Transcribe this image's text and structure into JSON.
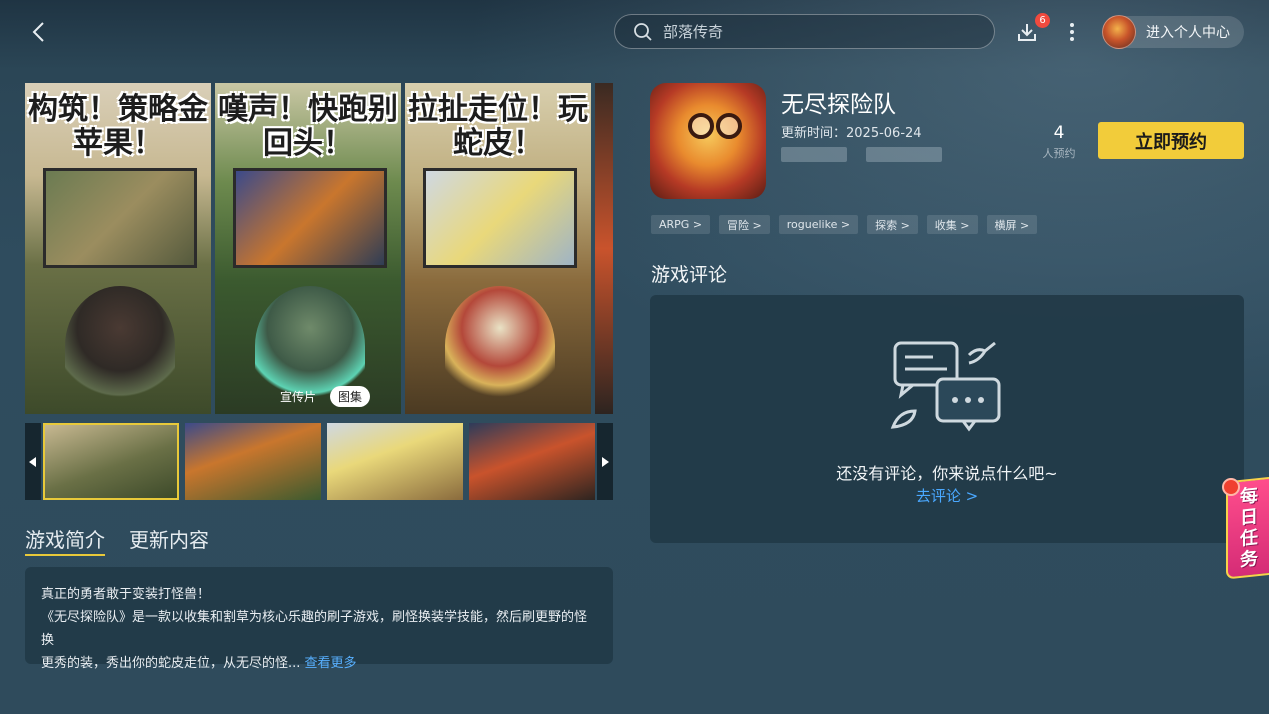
{
  "search": {
    "placeholder": "部落传奇"
  },
  "header": {
    "download_badge": "6",
    "profile_label": "进入个人中心"
  },
  "gallery": {
    "headlines": [
      "构筑！策略金苹果！",
      "嘆声！快跑别回头！",
      "拉扯走位！玩蛇皮！"
    ],
    "mode_options": [
      "宣传片",
      "图集"
    ],
    "active_mode": "图集"
  },
  "intro": {
    "tabs": [
      "游戏简介",
      "更新内容"
    ],
    "active_tab": "游戏简介",
    "line1": "真正的勇者敢于变装打怪兽！",
    "line2": "《无尽探险队》是一款以收集和割草为核心乐趣的刷子游戏，刷怪换装学技能，然后刷更野的怪换",
    "line3": "更秀的装，秀出你的蛇皮走位，从无尽的怪...",
    "more_label": "查看更多"
  },
  "game": {
    "title": "无尽探险队",
    "update_time": "更新时间：2025-06-24",
    "reserve_count": "4",
    "reserve_count_label": "人预约",
    "reserve_button": "立即预约",
    "tags": [
      "ARPG >",
      "冒险 >",
      "roguelike >",
      "探索 >",
      "收集 >",
      "横屏 >"
    ]
  },
  "reviews": {
    "title": "游戏评论",
    "empty_text": "还没有评论，你来说点什么吧~",
    "go_review": "去评论 >"
  },
  "daily_task": {
    "label": [
      "每",
      "日",
      "任",
      "务"
    ]
  },
  "colors": {
    "accent_yellow": "#f2cc3a",
    "link_blue": "#4aa8ff",
    "badge_red": "#f04a3e"
  }
}
